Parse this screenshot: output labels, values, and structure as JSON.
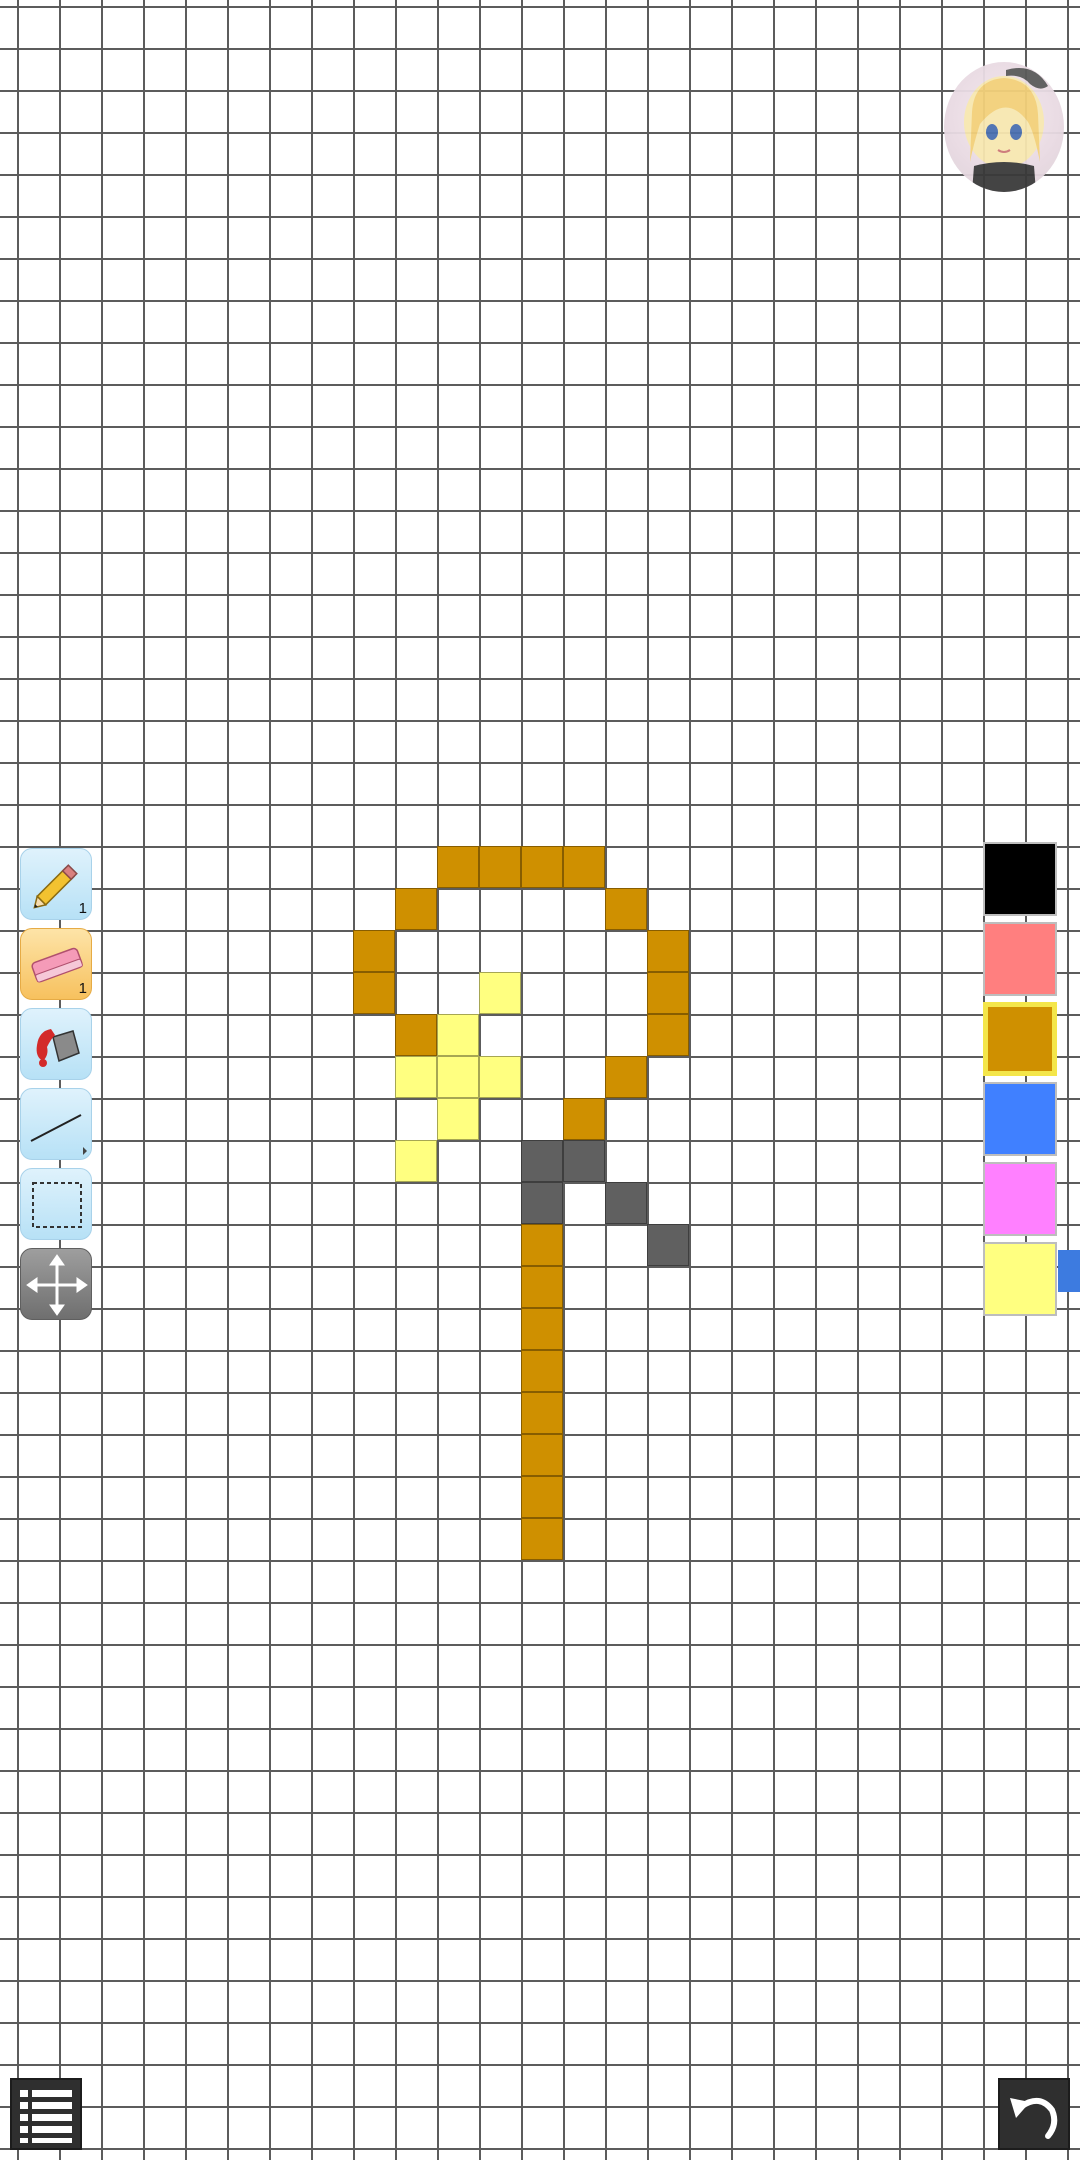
{
  "canvas": {
    "grid_color": "#5c5c5c",
    "background": "#ffffff",
    "pixels": [
      {
        "c": "gold",
        "col": 10,
        "row": 20
      },
      {
        "c": "gold",
        "col": 11,
        "row": 20
      },
      {
        "c": "gold",
        "col": 12,
        "row": 20
      },
      {
        "c": "gold",
        "col": 13,
        "row": 20
      },
      {
        "c": "gold",
        "col": 9,
        "row": 21
      },
      {
        "c": "gold",
        "col": 14,
        "row": 21
      },
      {
        "c": "gold",
        "col": 8,
        "row": 22
      },
      {
        "c": "gold",
        "col": 15,
        "row": 22
      },
      {
        "c": "gold",
        "col": 8,
        "row": 23
      },
      {
        "c": "yellow",
        "col": 11,
        "row": 23
      },
      {
        "c": "gold",
        "col": 15,
        "row": 23
      },
      {
        "c": "gold",
        "col": 9,
        "row": 24
      },
      {
        "c": "yellow",
        "col": 10,
        "row": 24
      },
      {
        "c": "gold",
        "col": 15,
        "row": 24
      },
      {
        "c": "yellow",
        "col": 9,
        "row": 25
      },
      {
        "c": "yellow",
        "col": 10,
        "row": 25
      },
      {
        "c": "yellow",
        "col": 11,
        "row": 25
      },
      {
        "c": "gold",
        "col": 14,
        "row": 25
      },
      {
        "c": "yellow",
        "col": 10,
        "row": 26
      },
      {
        "c": "gold",
        "col": 13,
        "row": 26
      },
      {
        "c": "yellow",
        "col": 9,
        "row": 27
      },
      {
        "c": "gray",
        "col": 12,
        "row": 27
      },
      {
        "c": "gray",
        "col": 13,
        "row": 27
      },
      {
        "c": "gray",
        "col": 12,
        "row": 28
      },
      {
        "c": "gray",
        "col": 14,
        "row": 28
      },
      {
        "c": "gold",
        "col": 12,
        "row": 29
      },
      {
        "c": "gray",
        "col": 15,
        "row": 29
      },
      {
        "c": "gold",
        "col": 12,
        "row": 30
      },
      {
        "c": "gold",
        "col": 12,
        "row": 31
      },
      {
        "c": "gold",
        "col": 12,
        "row": 32
      },
      {
        "c": "gold",
        "col": 12,
        "row": 33
      },
      {
        "c": "gold",
        "col": 12,
        "row": 34
      },
      {
        "c": "gold",
        "col": 12,
        "row": 35
      },
      {
        "c": "gold",
        "col": 12,
        "row": 36
      }
    ],
    "color_map": {
      "gold": "#cf9000",
      "yellow": "#ffff80",
      "gray": "#606060"
    }
  },
  "toolbar": {
    "tools": [
      {
        "name": "pencil",
        "icon": "pencil-icon",
        "count": "1",
        "active": false
      },
      {
        "name": "eraser",
        "icon": "eraser-icon",
        "count": "1",
        "active": true
      },
      {
        "name": "fill",
        "icon": "paint-bucket-icon",
        "count": "",
        "active": false
      },
      {
        "name": "line",
        "icon": "line-icon",
        "count": "",
        "active": false
      },
      {
        "name": "select",
        "icon": "selection-icon",
        "count": "",
        "active": false
      },
      {
        "name": "move",
        "icon": "move-arrows-icon",
        "count": "",
        "active": false
      }
    ]
  },
  "palette": {
    "colors": [
      "#000000",
      "#ff7f7f",
      "#cf9000",
      "#4080ff",
      "#ff80ff",
      "#ffff80"
    ],
    "selected_index": 2,
    "scroll_hint_color": "#3d7be0"
  },
  "avatar": {
    "icon": "character-avatar-icon"
  },
  "bottom": {
    "menu_icon": "menu-list-icon",
    "undo_icon": "undo-icon"
  }
}
